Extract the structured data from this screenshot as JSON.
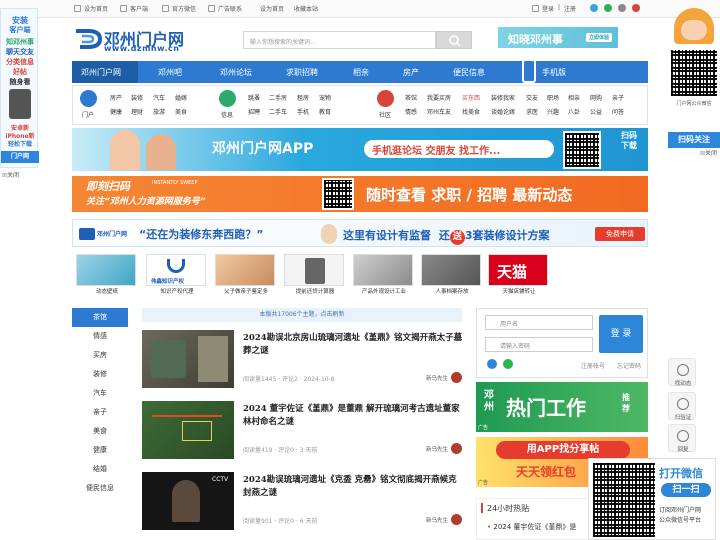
{
  "topbar": {
    "items": [
      "设为首页",
      "客户端",
      "官方微信",
      "广告联系",
      "设为首页",
      "收藏本站"
    ],
    "login": "登录",
    "sep": "|",
    "register": "注册"
  },
  "header": {
    "logo_cn": "邓州门户网",
    "logo_url": "www.dzmhw.cn",
    "search_placeholder": "输入你想搜索的关键词...",
    "banner_text": "知晓邓州事",
    "banner_btn": "立即体验"
  },
  "nav": {
    "items": [
      "邓州门户网",
      "邓州吧",
      "邓州论坛",
      "求职招聘",
      "相亲",
      "房产",
      "便民信息",
      "手机版"
    ]
  },
  "categories": {
    "groups": [
      {
        "label": "门户",
        "color": "#2e7ad1",
        "links": [
          [
            "房产",
            "装修",
            "汽车",
            "婚嫁"
          ],
          [
            "健康",
            "理财",
            "旅游",
            "美食"
          ]
        ]
      },
      {
        "label": "信息",
        "color": "#2fa86b",
        "links": [
          [
            "跳蚤",
            "二手房",
            "租房",
            "宠物"
          ],
          [
            "招聘",
            "二手车",
            "手机",
            "教育"
          ]
        ]
      },
      {
        "label": "社区",
        "color": "#d9443a",
        "links": [
          [
            "茶馆",
            "我要买房",
            "买东西",
            "装修我家",
            "交友",
            "职场",
            "相亲",
            "网购",
            "亲子"
          ],
          [
            "情感",
            "邓州车友",
            "找美食",
            "谈婚论嫁",
            "求医",
            "兴趣",
            "八卦",
            "公益",
            "问答"
          ]
        ]
      }
    ],
    "highlight": "买东西"
  },
  "ads": {
    "app_title": "邓州门户网APP",
    "app_sub": "手机逛论坛  交朋友  找工作...",
    "app_side": [
      "扫",
      "码",
      "下",
      "载"
    ],
    "hr_left1": "即刻扫码",
    "hr_left1_en": "INSTANTLY SWEEP",
    "hr_left2": "关注“邓州人力资源网服务号”",
    "hr_right": "随时查看 求职 / 招聘 最新动态",
    "deco_brand": "邓州门户网",
    "deco_q": "“还在为装修东奔西跑？”",
    "deco_main1": "这里有设计有监督",
    "deco_main2": "还",
    "deco_gift": "送",
    "deco_main3": "3套装修设计方案",
    "deco_btn": "免费申请"
  },
  "thumbs": {
    "items": [
      "动态壁纸",
      "知识产权代理",
      "父子做亲子鉴定多",
      "提前还贷计算器",
      "产品外观设计工业",
      "人事档案存放",
      "天猫店铺转让"
    ],
    "brand_zs": "伟鑫知识产权",
    "brand_tm": "天猫"
  },
  "sidebar": {
    "items": [
      "茶馆",
      "情感",
      "买房",
      "装修",
      "汽车",
      "亲子",
      "美食",
      "健康",
      "结婚",
      "便民信息"
    ]
  },
  "notice": "本版共17006个主题，点击刷新",
  "articles": [
    {
      "title": "2024勘误北京房山琉璃河遗址《堇鼎》铭文揭开燕太子墓葬之谜",
      "meta": "阅读量1445 · 评论2 · 2024-10-8",
      "author": "新乌先生"
    },
    {
      "title": "2024 董宇佐证《堇鼎》是董鼎 解开琉璃河考古遗址董家林村命名之谜",
      "meta": "阅读量419 · 评论0 · 3 天前",
      "author": "新乌先生"
    },
    {
      "title": "2024勘误琉璃河遗址《克盉 克罍》铭文彻底揭开燕候克封燕之谜",
      "meta": "阅读量901 · 评论0 · 6 天前",
      "author": "新乌先生"
    }
  ],
  "login": {
    "user_ph": "用户名",
    "pass_ph": "请输入密码",
    "btn": "登 录",
    "register": "注册帐号",
    "forgot": "忘记密码"
  },
  "hotjob": {
    "city": "邓州",
    "title": "热门工作",
    "tag1": "推",
    "tag2": "荐",
    "ad": "广告"
  },
  "hotapp": {
    "line1": "用APP找分享帖",
    "line2": "天天领红包",
    "ad": "广告"
  },
  "h24": {
    "title": "24小时热贴",
    "first": "2024 董宇佐证《堇鼎》是"
  },
  "leftfloat": {
    "lines": [
      "安装",
      "客户端",
      "知邓州事",
      "聊天交友",
      "分类信息",
      "好帖",
      "随身看",
      "安卓新",
      "iPhone新",
      "轻松下载",
      "门户网"
    ],
    "close": "关闭"
  },
  "rightfloat": {
    "label": "门户网公众微信",
    "scan": "扫码关注",
    "close": "关闭"
  },
  "tools": [
    "找动态",
    "扫验证",
    "回复"
  ],
  "qrfloat": {
    "line1": "打开微信",
    "line2": "扫一扫",
    "line3": "订阅邓州门户网",
    "line4": "公众微信号平台"
  },
  "colors": {
    "primary": "#2e7ad1",
    "accent": "#f26a21",
    "green": "#2fa86b",
    "red": "#d9443a"
  }
}
